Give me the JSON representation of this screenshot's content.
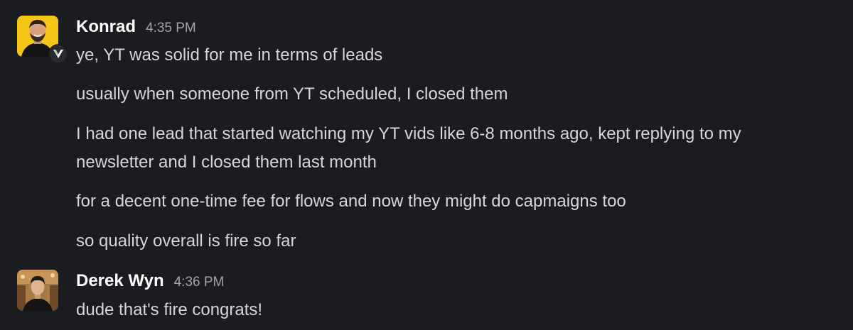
{
  "messages": [
    {
      "author": "Konrad",
      "time": "4:35 PM",
      "lines": [
        "ye, YT was solid for me in terms of leads",
        "usually when someone from YT scheduled, I closed them",
        "I had one lead that started watching my YT vids like 6-8 months ago, kept replying to my",
        "newsletter and I closed them last month",
        "for a decent one-time fee for flows and now they might do capmaigns too",
        "so quality overall is fire so far"
      ]
    },
    {
      "author": "Derek Wyn",
      "time": "4:36 PM",
      "lines": [
        "dude that's fire congrats!"
      ]
    }
  ],
  "colors": {
    "background": "#1b1c20",
    "author": "#ffffff",
    "text": "#d5d6d8",
    "timestamp": "#a4a5a8",
    "konrad_avatar_bg": "#f5c518"
  },
  "icons": {
    "konrad_avatar": "konrad-avatar",
    "derek_avatar": "derek-avatar",
    "app_badge": "v-logo-icon"
  }
}
